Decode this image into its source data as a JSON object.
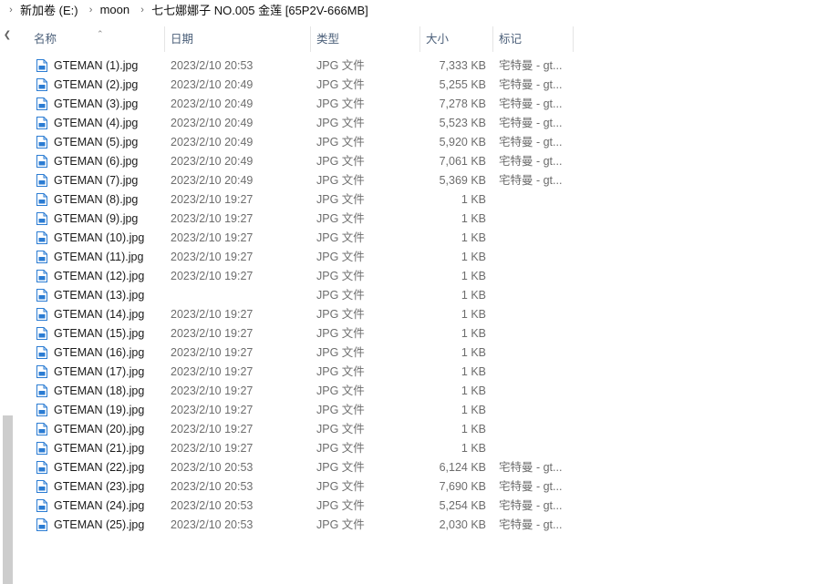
{
  "breadcrumb": [
    "新加卷 (E:)",
    "moon",
    "七七娜娜子 NO.005 金莲 [65P2V-666MB]"
  ],
  "columns": {
    "name": "名称",
    "date": "日期",
    "type": "类型",
    "size": "大小",
    "tag": "标记"
  },
  "icons": {
    "file": "jpg-file-icon",
    "scroll_up": "chevron-up-icon",
    "sort": "sort-ascending-icon",
    "separator": "chevron-right-icon"
  },
  "colors": {
    "icon_blue": "#2b7cd3",
    "header_text": "#4c607a",
    "scroll_thumb": "#cdcdcd"
  },
  "files": [
    {
      "name": "GTEMAN (1).jpg",
      "date": "2023/2/10 20:53",
      "type": "JPG 文件",
      "size": "7,333 KB",
      "tag": "宅特曼 - gt..."
    },
    {
      "name": "GTEMAN (2).jpg",
      "date": "2023/2/10 20:49",
      "type": "JPG 文件",
      "size": "5,255 KB",
      "tag": "宅特曼 - gt..."
    },
    {
      "name": "GTEMAN (3).jpg",
      "date": "2023/2/10 20:49",
      "type": "JPG 文件",
      "size": "7,278 KB",
      "tag": "宅特曼 - gt..."
    },
    {
      "name": "GTEMAN (4).jpg",
      "date": "2023/2/10 20:49",
      "type": "JPG 文件",
      "size": "5,523 KB",
      "tag": "宅特曼 - gt..."
    },
    {
      "name": "GTEMAN (5).jpg",
      "date": "2023/2/10 20:49",
      "type": "JPG 文件",
      "size": "5,920 KB",
      "tag": "宅特曼 - gt..."
    },
    {
      "name": "GTEMAN (6).jpg",
      "date": "2023/2/10 20:49",
      "type": "JPG 文件",
      "size": "7,061 KB",
      "tag": "宅特曼 - gt..."
    },
    {
      "name": "GTEMAN (7).jpg",
      "date": "2023/2/10 20:49",
      "type": "JPG 文件",
      "size": "5,369 KB",
      "tag": "宅特曼 - gt..."
    },
    {
      "name": "GTEMAN (8).jpg",
      "date": "2023/2/10 19:27",
      "type": "JPG 文件",
      "size": "1 KB",
      "tag": ""
    },
    {
      "name": "GTEMAN (9).jpg",
      "date": "2023/2/10 19:27",
      "type": "JPG 文件",
      "size": "1 KB",
      "tag": ""
    },
    {
      "name": "GTEMAN (10).jpg",
      "date": "2023/2/10 19:27",
      "type": "JPG 文件",
      "size": "1 KB",
      "tag": ""
    },
    {
      "name": "GTEMAN (11).jpg",
      "date": "2023/2/10 19:27",
      "type": "JPG 文件",
      "size": "1 KB",
      "tag": ""
    },
    {
      "name": "GTEMAN (12).jpg",
      "date": "2023/2/10 19:27",
      "type": "JPG 文件",
      "size": "1 KB",
      "tag": ""
    },
    {
      "name": "GTEMAN (13).jpg",
      "date": "",
      "type": "JPG 文件",
      "size": "1 KB",
      "tag": ""
    },
    {
      "name": "GTEMAN (14).jpg",
      "date": "2023/2/10 19:27",
      "type": "JPG 文件",
      "size": "1 KB",
      "tag": ""
    },
    {
      "name": "GTEMAN (15).jpg",
      "date": "2023/2/10 19:27",
      "type": "JPG 文件",
      "size": "1 KB",
      "tag": ""
    },
    {
      "name": "GTEMAN (16).jpg",
      "date": "2023/2/10 19:27",
      "type": "JPG 文件",
      "size": "1 KB",
      "tag": ""
    },
    {
      "name": "GTEMAN (17).jpg",
      "date": "2023/2/10 19:27",
      "type": "JPG 文件",
      "size": "1 KB",
      "tag": ""
    },
    {
      "name": "GTEMAN (18).jpg",
      "date": "2023/2/10 19:27",
      "type": "JPG 文件",
      "size": "1 KB",
      "tag": ""
    },
    {
      "name": "GTEMAN (19).jpg",
      "date": "2023/2/10 19:27",
      "type": "JPG 文件",
      "size": "1 KB",
      "tag": ""
    },
    {
      "name": "GTEMAN (20).jpg",
      "date": "2023/2/10 19:27",
      "type": "JPG 文件",
      "size": "1 KB",
      "tag": ""
    },
    {
      "name": "GTEMAN (21).jpg",
      "date": "2023/2/10 19:27",
      "type": "JPG 文件",
      "size": "1 KB",
      "tag": ""
    },
    {
      "name": "GTEMAN (22).jpg",
      "date": "2023/2/10 20:53",
      "type": "JPG 文件",
      "size": "6,124 KB",
      "tag": "宅特曼 - gt..."
    },
    {
      "name": "GTEMAN (23).jpg",
      "date": "2023/2/10 20:53",
      "type": "JPG 文件",
      "size": "7,690 KB",
      "tag": "宅特曼 - gt..."
    },
    {
      "name": "GTEMAN (24).jpg",
      "date": "2023/2/10 20:53",
      "type": "JPG 文件",
      "size": "5,254 KB",
      "tag": "宅特曼 - gt..."
    },
    {
      "name": "GTEMAN (25).jpg",
      "date": "2023/2/10 20:53",
      "type": "JPG 文件",
      "size": "2,030 KB",
      "tag": "宅特曼 - gt..."
    }
  ]
}
